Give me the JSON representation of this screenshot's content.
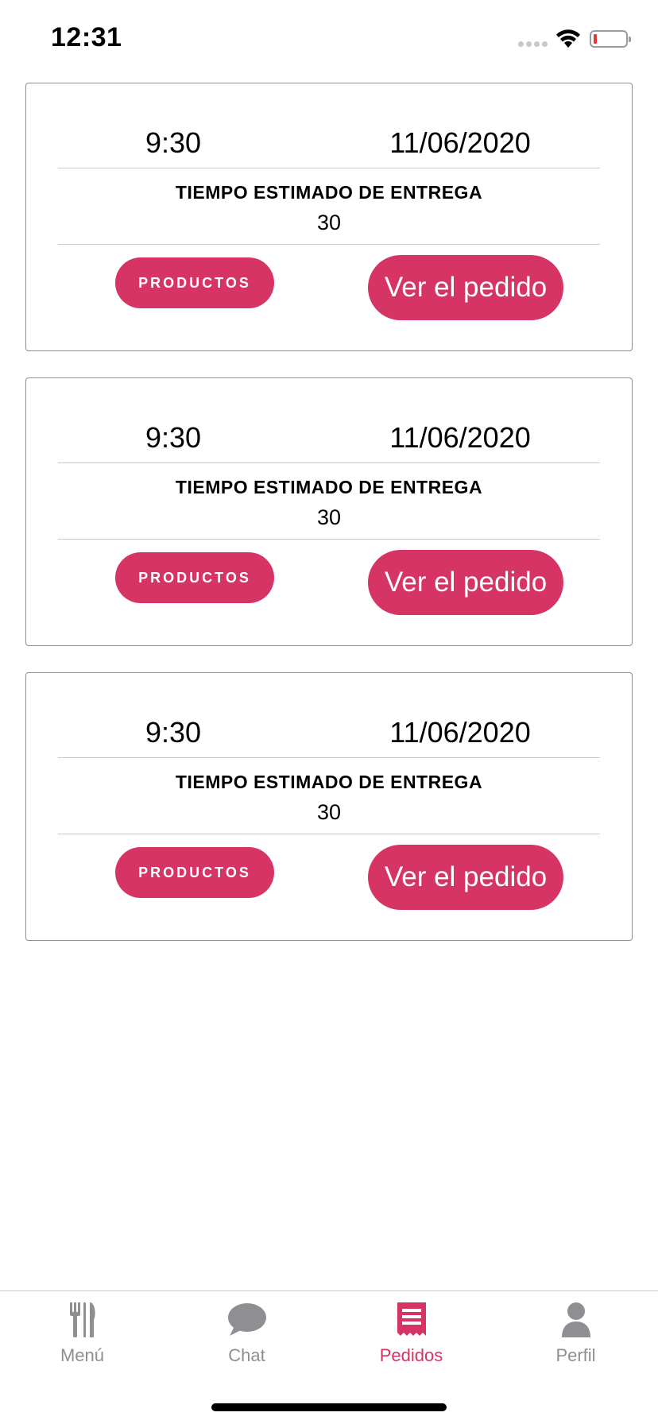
{
  "status_bar": {
    "time": "12:31"
  },
  "orders": [
    {
      "time": "9:30",
      "date": "11/06/2020",
      "eta_label": "TIEMPO ESTIMADO DE ENTREGA",
      "eta_value": "30",
      "products_label": "PRODUCTOS",
      "view_label": "Ver el pedido"
    },
    {
      "time": "9:30",
      "date": "11/06/2020",
      "eta_label": "TIEMPO ESTIMADO DE ENTREGA",
      "eta_value": "30",
      "products_label": "PRODUCTOS",
      "view_label": "Ver el pedido"
    },
    {
      "time": "9:30",
      "date": "11/06/2020",
      "eta_label": "TIEMPO ESTIMADO DE ENTREGA",
      "eta_value": "30",
      "products_label": "PRODUCTOS",
      "view_label": "Ver el pedido"
    }
  ],
  "tab_bar": {
    "tabs": [
      {
        "label": "Menú",
        "icon": "cutlery-icon",
        "active": false
      },
      {
        "label": "Chat",
        "icon": "chat-bubble-icon",
        "active": false
      },
      {
        "label": "Pedidos",
        "icon": "receipt-icon",
        "active": true
      },
      {
        "label": "Perfil",
        "icon": "person-icon",
        "active": false
      }
    ]
  },
  "colors": {
    "accent": "#d63464",
    "inactive_tab": "#8e8e93",
    "card_border": "#8e8e8e"
  }
}
